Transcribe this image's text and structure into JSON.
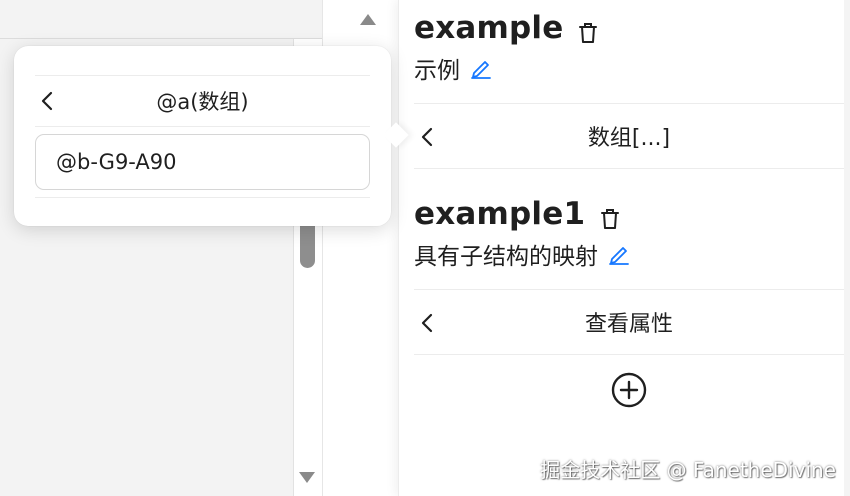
{
  "popover": {
    "title": "@a(数组)",
    "input_value": "@b-G9-A90"
  },
  "entries": [
    {
      "title": "example",
      "description": "示例"
    },
    {
      "title": "example1",
      "description": "具有子结构的映射"
    }
  ],
  "nav_rows": [
    {
      "label": "数组[...]"
    },
    {
      "label": "查看属性"
    }
  ],
  "watermark": "掘金技术社区 @ FanetheDivine",
  "icons": {
    "delete": "trash-icon",
    "edit": "pencil-icon",
    "back": "chevron-left-icon",
    "add": "plus-circle-icon"
  },
  "colors": {
    "accent": "#1677ff",
    "text": "#1f1f1f"
  }
}
